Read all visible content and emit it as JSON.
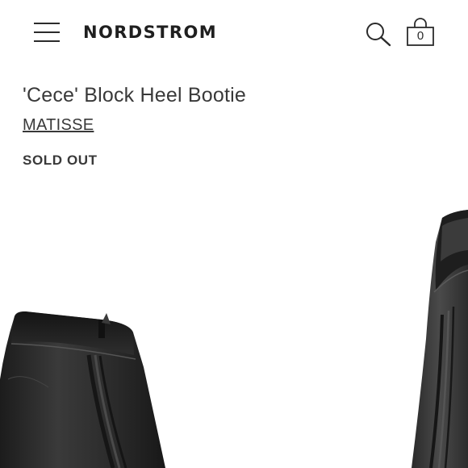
{
  "header": {
    "menu_icon": "hamburger-menu-icon",
    "logo": "NORDSTROM",
    "search_icon": "search-icon",
    "bag_icon": "shopping-bag-icon",
    "bag_count": "0"
  },
  "product": {
    "title": "'Cece' Block Heel Bootie",
    "brand": "MATISSE",
    "status": "SOLD OUT"
  },
  "colors": {
    "text": "#393939",
    "boot_leather": "#2a2a2a",
    "background": "#ffffff"
  }
}
